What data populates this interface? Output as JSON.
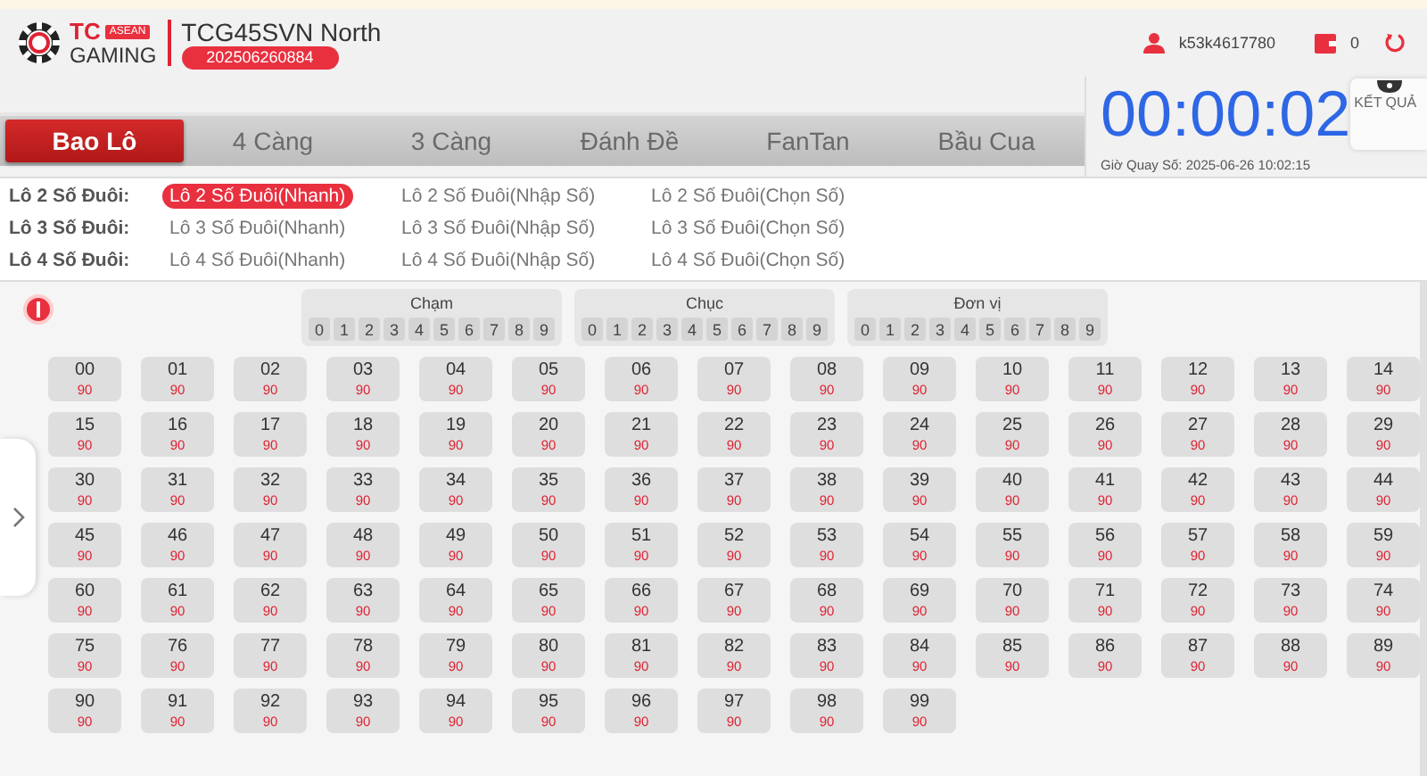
{
  "header": {
    "brand_top": "TC",
    "brand_badge": "ASEAN",
    "brand_bottom": "GAMING",
    "title": "TCG45SVN North",
    "draw_id": "202506260884",
    "username": "k53k4617780",
    "balance": "0"
  },
  "tabs": [
    {
      "label": "Bao Lô",
      "selected": true
    },
    {
      "label": "4 Càng",
      "selected": false
    },
    {
      "label": "3 Càng",
      "selected": false
    },
    {
      "label": "Đánh Đề",
      "selected": false
    },
    {
      "label": "FanTan",
      "selected": false
    },
    {
      "label": "Bầu Cua",
      "selected": false
    }
  ],
  "timer": {
    "countdown": "00:00:02",
    "draw_time": "Giờ Quay Số: 2025-06-26 10:02:15",
    "results_label": "KẾT QUẢ"
  },
  "bet_types": [
    {
      "label": "Lô 2 Số Đuôi:",
      "options": [
        {
          "label": "Lô 2 Số Đuôi(Nhanh)",
          "selected": true
        },
        {
          "label": "Lô 2 Số Đuôi(Nhập Số)",
          "selected": false
        },
        {
          "label": "Lô 2 Số Đuôi(Chọn Số)",
          "selected": false
        }
      ]
    },
    {
      "label": "Lô 3 Số Đuôi:",
      "options": [
        {
          "label": "Lô 3 Số Đuôi(Nhanh)",
          "selected": false
        },
        {
          "label": "Lô 3 Số Đuôi(Nhập Số)",
          "selected": false
        },
        {
          "label": "Lô 3 Số Đuôi(Chọn Số)",
          "selected": false
        }
      ]
    },
    {
      "label": "Lô 4 Số Đuôi:",
      "options": [
        {
          "label": "Lô 4 Số Đuôi(Nhanh)",
          "selected": false
        },
        {
          "label": "Lô 4 Số Đuôi(Nhập Số)",
          "selected": false
        },
        {
          "label": "Lô 4 Số Đuôi(Chọn Số)",
          "selected": false
        }
      ]
    }
  ],
  "digit_groups": [
    {
      "title": "Chạm",
      "digits": [
        "0",
        "1",
        "2",
        "3",
        "4",
        "5",
        "6",
        "7",
        "8",
        "9"
      ]
    },
    {
      "title": "Chục",
      "digits": [
        "0",
        "1",
        "2",
        "3",
        "4",
        "5",
        "6",
        "7",
        "8",
        "9"
      ]
    },
    {
      "title": "Đơn vị",
      "digits": [
        "0",
        "1",
        "2",
        "3",
        "4",
        "5",
        "6",
        "7",
        "8",
        "9"
      ]
    }
  ],
  "numbers": [
    {
      "number": "00",
      "odds": "90",
      "selected": false
    },
    {
      "number": "01",
      "odds": "90",
      "selected": false
    },
    {
      "number": "02",
      "odds": "90",
      "selected": false
    },
    {
      "number": "03",
      "odds": "90",
      "selected": false
    },
    {
      "number": "04",
      "odds": "90",
      "selected": false
    },
    {
      "number": "05",
      "odds": "90",
      "selected": false
    },
    {
      "number": "06",
      "odds": "90",
      "selected": false
    },
    {
      "number": "07",
      "odds": "90",
      "selected": false
    },
    {
      "number": "08",
      "odds": "90",
      "selected": false
    },
    {
      "number": "09",
      "odds": "90",
      "selected": false
    },
    {
      "number": "10",
      "odds": "90",
      "selected": false
    },
    {
      "number": "11",
      "odds": "90",
      "selected": false
    },
    {
      "number": "12",
      "odds": "90",
      "selected": false
    },
    {
      "number": "13",
      "odds": "90",
      "selected": false
    },
    {
      "number": "14",
      "odds": "90",
      "selected": false
    },
    {
      "number": "15",
      "odds": "90",
      "selected": false
    },
    {
      "number": "16",
      "odds": "90",
      "selected": false
    },
    {
      "number": "17",
      "odds": "90",
      "selected": false
    },
    {
      "number": "18",
      "odds": "90",
      "selected": false
    },
    {
      "number": "19",
      "odds": "90",
      "selected": false
    },
    {
      "number": "20",
      "odds": "90",
      "selected": false
    },
    {
      "number": "21",
      "odds": "90",
      "selected": false
    },
    {
      "number": "22",
      "odds": "90",
      "selected": false
    },
    {
      "number": "23",
      "odds": "90",
      "selected": false
    },
    {
      "number": "24",
      "odds": "90",
      "selected": false
    },
    {
      "number": "25",
      "odds": "90",
      "selected": false
    },
    {
      "number": "26",
      "odds": "90",
      "selected": false
    },
    {
      "number": "27",
      "odds": "90",
      "selected": false
    },
    {
      "number": "28",
      "odds": "90",
      "selected": false
    },
    {
      "number": "29",
      "odds": "90",
      "selected": false
    },
    {
      "number": "30",
      "odds": "90",
      "selected": false
    },
    {
      "number": "31",
      "odds": "90",
      "selected": false
    },
    {
      "number": "32",
      "odds": "90",
      "selected": false
    },
    {
      "number": "33",
      "odds": "90",
      "selected": false
    },
    {
      "number": "34",
      "odds": "90",
      "selected": false
    },
    {
      "number": "35",
      "odds": "90",
      "selected": false
    },
    {
      "number": "36",
      "odds": "90",
      "selected": false
    },
    {
      "number": "37",
      "odds": "90",
      "selected": false
    },
    {
      "number": "38",
      "odds": "90",
      "selected": false
    },
    {
      "number": "39",
      "odds": "90",
      "selected": false
    },
    {
      "number": "40",
      "odds": "90",
      "selected": false
    },
    {
      "number": "41",
      "odds": "90",
      "selected": false
    },
    {
      "number": "42",
      "odds": "90",
      "selected": false
    },
    {
      "number": "43",
      "odds": "90",
      "selected": false
    },
    {
      "number": "44",
      "odds": "90",
      "selected": false
    },
    {
      "number": "45",
      "odds": "90",
      "selected": false
    },
    {
      "number": "46",
      "odds": "90",
      "selected": false
    },
    {
      "number": "47",
      "odds": "90",
      "selected": false
    },
    {
      "number": "48",
      "odds": "90",
      "selected": false
    },
    {
      "number": "49",
      "odds": "90",
      "selected": false
    },
    {
      "number": "50",
      "odds": "90",
      "selected": false
    },
    {
      "number": "51",
      "odds": "90",
      "selected": false
    },
    {
      "number": "52",
      "odds": "90",
      "selected": false
    },
    {
      "number": "53",
      "odds": "90",
      "selected": false
    },
    {
      "number": "54",
      "odds": "90",
      "selected": false
    },
    {
      "number": "55",
      "odds": "90",
      "selected": false
    },
    {
      "number": "56",
      "odds": "90",
      "selected": false
    },
    {
      "number": "57",
      "odds": "90",
      "selected": false
    },
    {
      "number": "58",
      "odds": "90",
      "selected": false
    },
    {
      "number": "59",
      "odds": "90",
      "selected": false
    },
    {
      "number": "60",
      "odds": "90",
      "selected": false
    },
    {
      "number": "61",
      "odds": "90",
      "selected": false
    },
    {
      "number": "62",
      "odds": "90",
      "selected": false
    },
    {
      "number": "63",
      "odds": "90",
      "selected": false
    },
    {
      "number": "64",
      "odds": "90",
      "selected": false
    },
    {
      "number": "65",
      "odds": "90",
      "selected": false
    },
    {
      "number": "66",
      "odds": "90",
      "selected": false
    },
    {
      "number": "67",
      "odds": "90",
      "selected": false
    },
    {
      "number": "68",
      "odds": "90",
      "selected": false
    },
    {
      "number": "69",
      "odds": "90",
      "selected": false
    },
    {
      "number": "70",
      "odds": "90",
      "selected": false
    },
    {
      "number": "71",
      "odds": "90",
      "selected": false
    },
    {
      "number": "72",
      "odds": "90",
      "selected": false
    },
    {
      "number": "73",
      "odds": "90",
      "selected": false
    },
    {
      "number": "74",
      "odds": "90",
      "selected": false
    },
    {
      "number": "75",
      "odds": "90",
      "selected": false
    },
    {
      "number": "76",
      "odds": "90",
      "selected": false
    },
    {
      "number": "77",
      "odds": "90",
      "selected": false
    },
    {
      "number": "78",
      "odds": "90",
      "selected": false
    },
    {
      "number": "79",
      "odds": "90",
      "selected": false
    },
    {
      "number": "80",
      "odds": "90",
      "selected": false
    },
    {
      "number": "81",
      "odds": "90",
      "selected": false
    },
    {
      "number": "82",
      "odds": "90",
      "selected": false
    },
    {
      "number": "83",
      "odds": "90",
      "selected": false
    },
    {
      "number": "84",
      "odds": "90",
      "selected": false
    },
    {
      "number": "85",
      "odds": "90",
      "selected": false
    },
    {
      "number": "86",
      "odds": "90",
      "selected": false
    },
    {
      "number": "87",
      "odds": "90",
      "selected": false
    },
    {
      "number": "88",
      "odds": "90",
      "selected": false
    },
    {
      "number": "89",
      "odds": "90",
      "selected": false
    },
    {
      "number": "90",
      "odds": "90",
      "selected": false
    },
    {
      "number": "91",
      "odds": "90",
      "selected": false
    },
    {
      "number": "92",
      "odds": "90",
      "selected": false
    },
    {
      "number": "93",
      "odds": "90",
      "selected": false
    },
    {
      "number": "94",
      "odds": "90",
      "selected": false
    },
    {
      "number": "95",
      "odds": "90",
      "selected": false
    },
    {
      "number": "96",
      "odds": "90",
      "selected": false
    },
    {
      "number": "97",
      "odds": "90",
      "selected": false
    },
    {
      "number": "98",
      "odds": "90",
      "selected": false
    },
    {
      "number": "99",
      "odds": "90",
      "selected": false
    }
  ]
}
